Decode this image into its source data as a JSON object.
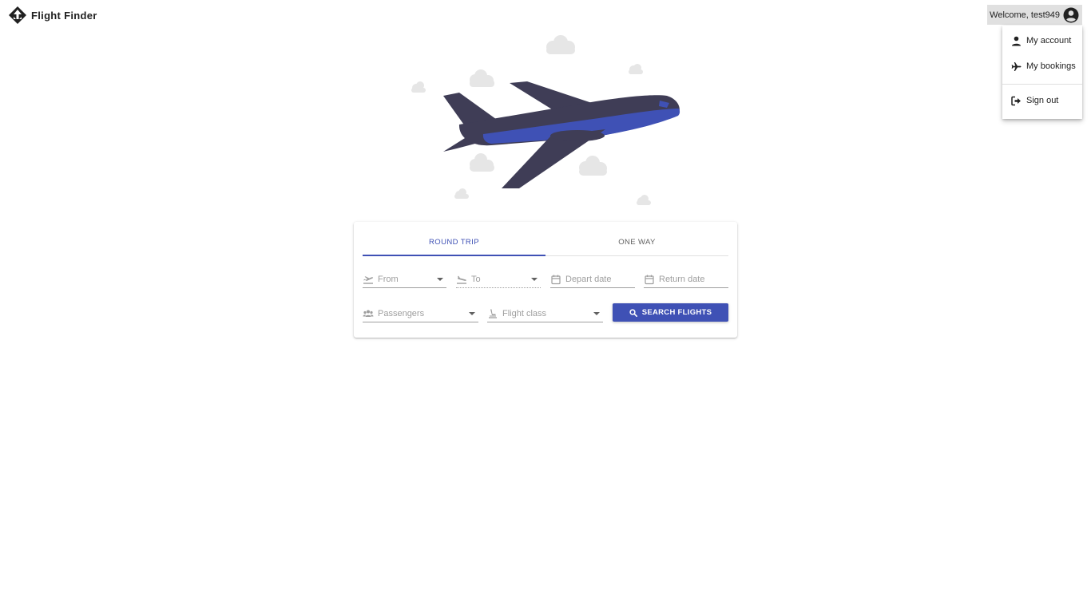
{
  "header": {
    "app_name": "Flight Finder",
    "logo_icon": "diamond-plane-logo",
    "welcome_label": "Welcome, test949",
    "avatar_icon": "account-circle-icon"
  },
  "user_menu": {
    "items": [
      {
        "label": "My account",
        "icon": "person-icon"
      },
      {
        "label": "My bookings",
        "icon": "airplane-icon"
      },
      {
        "label": "Sign out",
        "icon": "sign-out-icon"
      }
    ]
  },
  "search": {
    "tabs": [
      {
        "label": "ROUND TRIP",
        "active": true
      },
      {
        "label": "ONE WAY",
        "active": false
      }
    ],
    "from_placeholder": "From",
    "to_placeholder": "To",
    "depart_placeholder": "Depart date",
    "return_placeholder": "Return date",
    "passengers_placeholder": "Passengers",
    "class_placeholder": "Flight class",
    "search_label": "SEARCH FLIGHTS"
  },
  "colors": {
    "primary": "#3f51b5",
    "plane_body": "#3f3d56",
    "cloud": "#e6e6e6"
  }
}
